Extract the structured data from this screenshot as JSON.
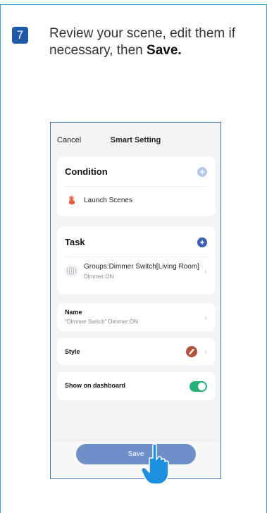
{
  "step": {
    "number": "7",
    "text_line1": "Review your scene, edit them if",
    "text_line2_prefix": "necessary, then ",
    "text_line2_bold": "Save."
  },
  "header": {
    "cancel_label": "Cancel",
    "title": "Smart Setting"
  },
  "condition": {
    "title": "Condition",
    "item_label": "Launch Scenes"
  },
  "task": {
    "title": "Task",
    "item_title": "Groups:Dimmer Switch[Living Room]",
    "item_subtitle": "Dimmer:ON"
  },
  "name": {
    "label": "Name",
    "value": "\"Dimmer Switch\" Dimmer:ON"
  },
  "style": {
    "label": "Style"
  },
  "dashboard": {
    "label": "Show on dashboard",
    "enabled": true
  },
  "save_label": "Save",
  "colors": {
    "accent": "#1e5aa8",
    "frame_border": "#3aa0d8",
    "toggle_on": "#23b37a",
    "save_button": "#6f8fc9",
    "hand": "#1e90e0"
  }
}
